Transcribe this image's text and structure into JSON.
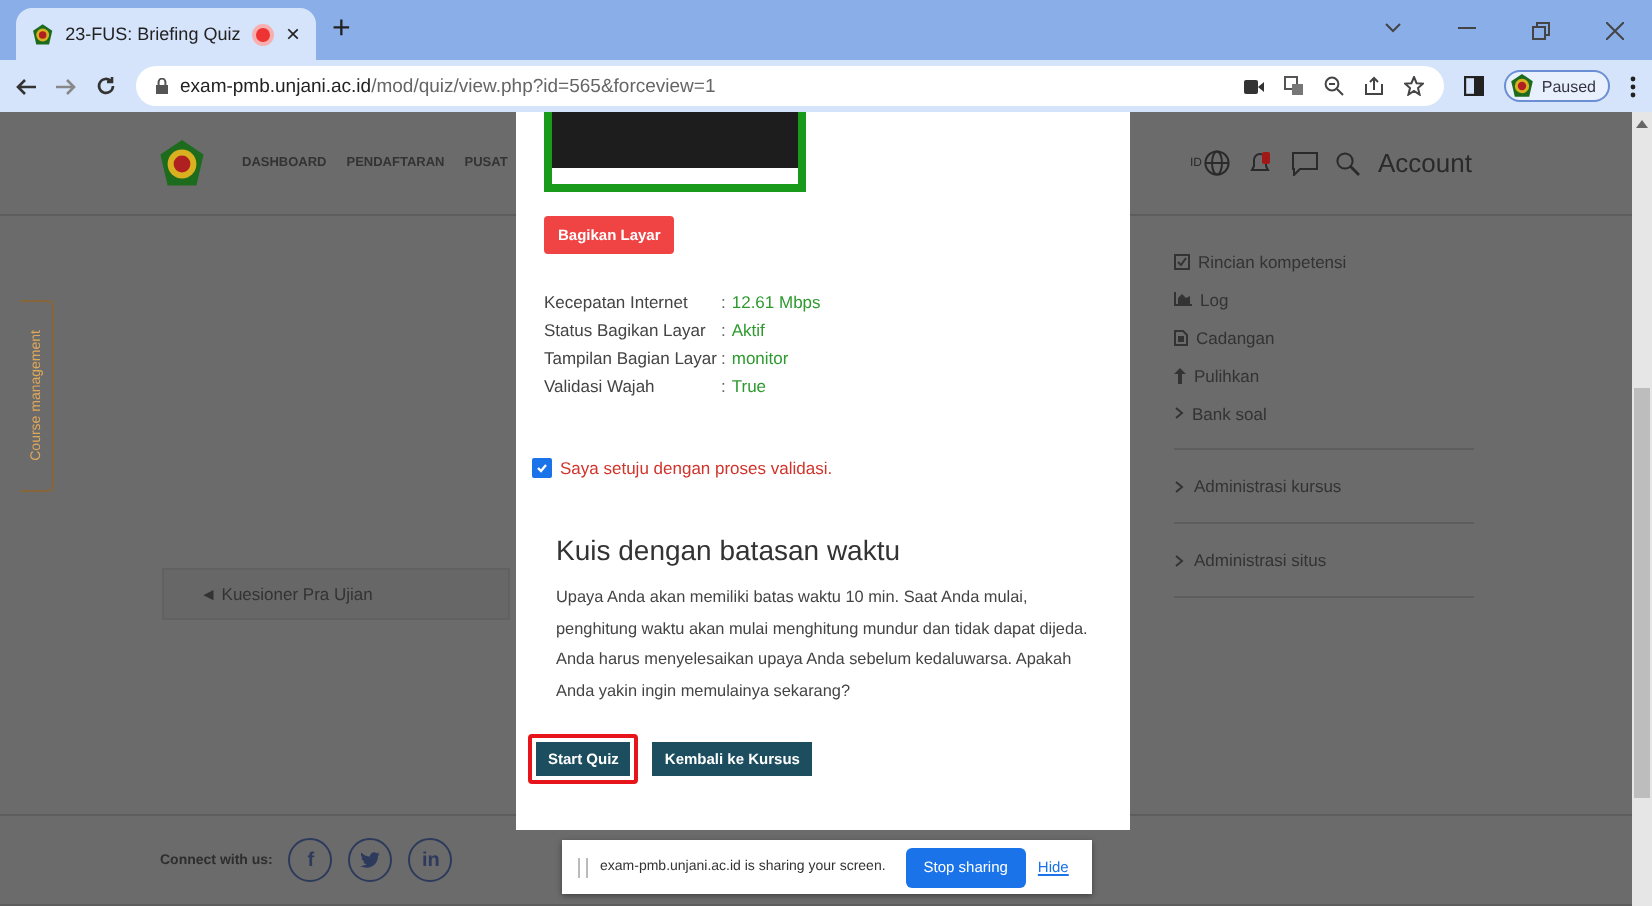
{
  "browser": {
    "tab": {
      "title": "23-FUS: Briefing Quiz",
      "recording": true,
      "close": "×"
    },
    "new_tab": "+",
    "url_host": "exam-pmb.unjani.ac.id",
    "url_path": "/mod/quiz/view.php?id=565&forceview=1",
    "profile": "Paused"
  },
  "site_header": {
    "nav": [
      "DASHBOARD",
      "PENDAFTARAN",
      "PUSAT"
    ],
    "language": "ID",
    "account": "Account"
  },
  "course_tab": "Course management",
  "nav_link": "◄ Kuesioner Pra Ujian",
  "sidebar": {
    "items": [
      {
        "kind": "check",
        "label": "Rincian kompetensi"
      },
      {
        "kind": "chart",
        "label": "Log"
      },
      {
        "kind": "file",
        "label": "Cadangan"
      },
      {
        "kind": "restore",
        "label": "Pulihkan"
      },
      {
        "kind": "caret",
        "label": "Bank soal"
      }
    ],
    "sections": [
      "Administrasi kursus",
      "Administrasi situs"
    ]
  },
  "footer": {
    "connect_label": "Connect with us:",
    "social": [
      {
        "kind": "text",
        "label": "f"
      },
      {
        "kind": "bird"
      },
      {
        "kind": "text",
        "label": "in"
      }
    ]
  },
  "modal": {
    "share_button": "Bagikan Layar",
    "status": [
      {
        "label": "Kecepatan Internet",
        "separator": ":",
        "value": "12.61 Mbps"
      },
      {
        "label": "Status Bagikan Layar",
        "separator": ":",
        "value": "Aktif"
      },
      {
        "label": "Tampilan Bagian Layar",
        "separator": ":",
        "value": "monitor"
      },
      {
        "label": "Validasi Wajah",
        "separator": ":",
        "value": "True"
      }
    ],
    "consent": {
      "label": "Saya setuju dengan proses validasi.",
      "checked": true
    },
    "heading": "Kuis dengan batasan waktu",
    "body": "Upaya Anda akan memiliki batas waktu 10 min. Saat Anda mulai, penghitung waktu akan mulai menghitung mundur dan tidak dapat dijeda. Anda harus menyelesaikan upaya Anda sebelum kedaluwarsa. Apakah Anda yakin ingin memulainya sekarang?",
    "buttons": [
      {
        "label": "Start Quiz",
        "highlighted": true
      },
      {
        "label": "Kembali ke Kursus",
        "highlighted": false
      }
    ]
  },
  "share_bar": {
    "message": "exam-pmb.unjani.ac.id is sharing your screen.",
    "stop": "Stop sharing",
    "hide": "Hide"
  }
}
